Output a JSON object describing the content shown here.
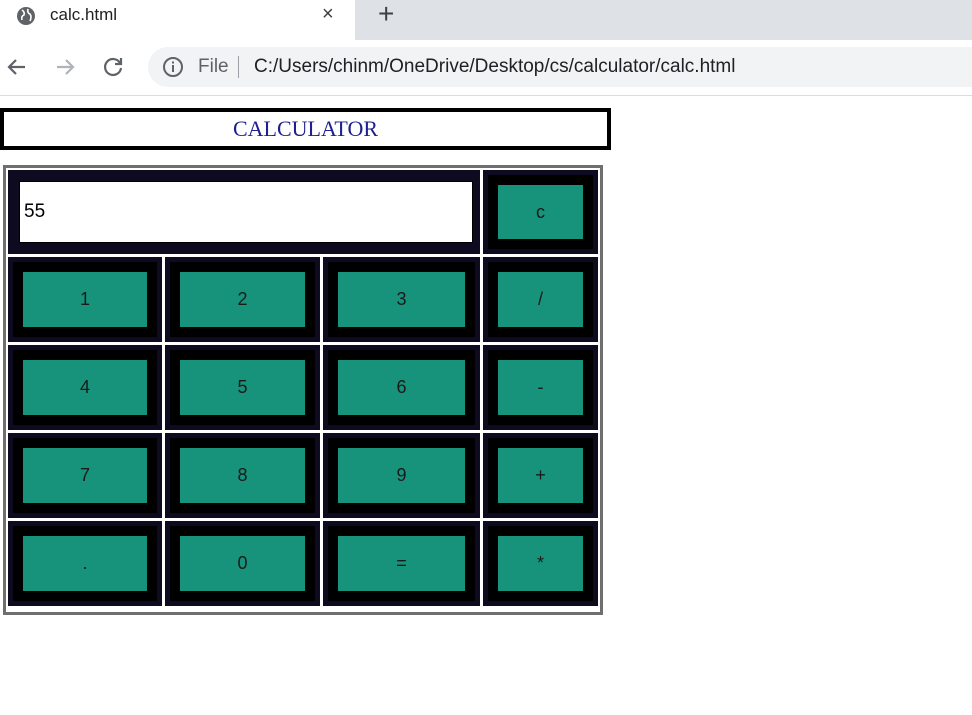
{
  "browser": {
    "tab_title": "calc.html",
    "close_icon": "×",
    "new_tab_icon": "+",
    "address_scheme": "File",
    "address_url": "C:/Users/chinm/OneDrive/Desktop/cs/calculator/calc.html"
  },
  "calculator": {
    "title": "CALCULATOR",
    "display_value": "55",
    "clear_label": "c",
    "rows": [
      [
        "1",
        "2",
        "3",
        "/"
      ],
      [
        "4",
        "5",
        "6",
        "-"
      ],
      [
        "7",
        "8",
        "9",
        "+"
      ],
      [
        ".",
        "0",
        "=",
        "*"
      ]
    ]
  },
  "colors": {
    "button": "#17937b",
    "cell": "#0e0a1f",
    "title_text": "#1f1f8f"
  }
}
